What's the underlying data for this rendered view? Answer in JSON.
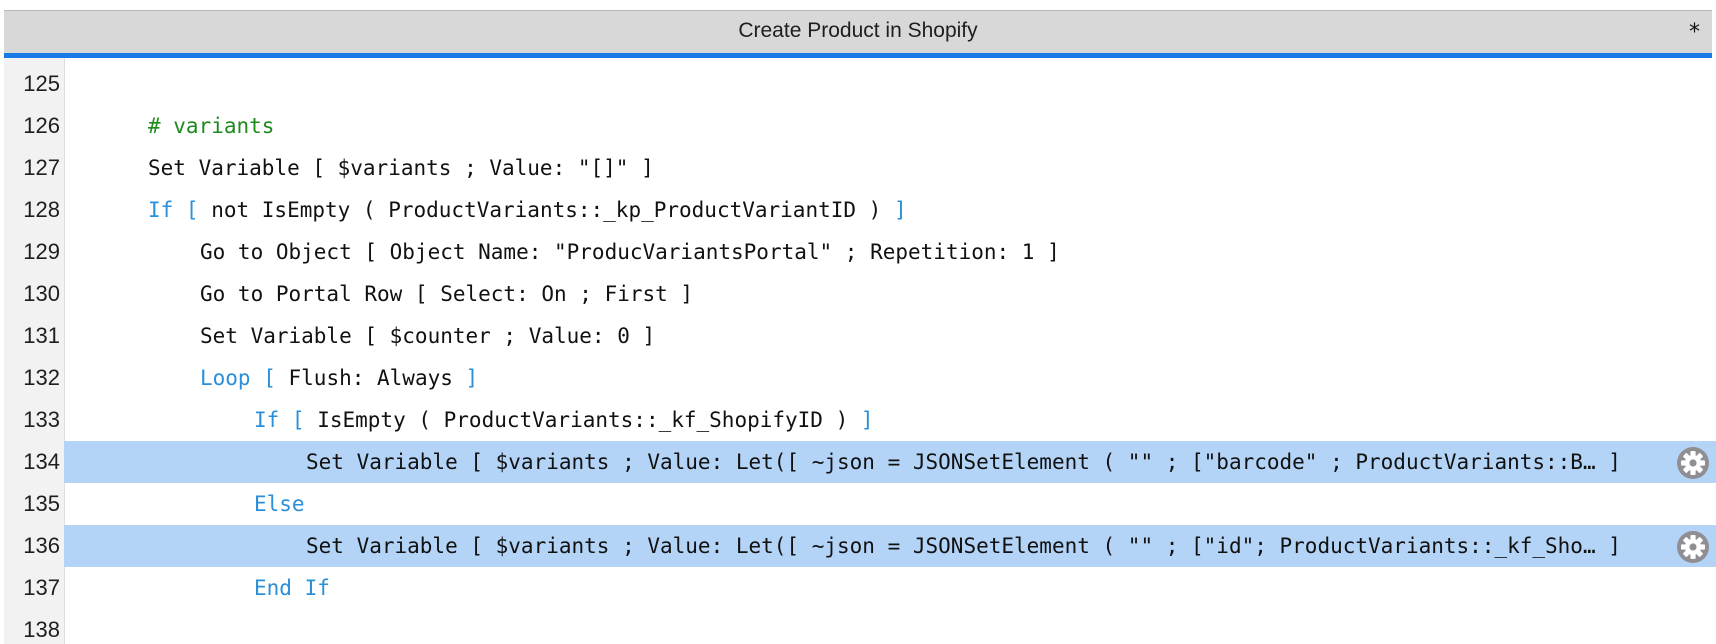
{
  "window": {
    "title": "Create Product in Shopify",
    "modified_marker": "*"
  },
  "colors": {
    "accent": "#1a7be6",
    "selection": "#b3d4f7",
    "keyword": "#2a8fd8",
    "comment": "#1e8a1e"
  },
  "script": {
    "lines": [
      {
        "num": "125",
        "indent": 0,
        "selected": false,
        "parts": []
      },
      {
        "num": "126",
        "indent": 0,
        "selected": false,
        "parts": [
          {
            "t": "# variants",
            "c": "cm"
          }
        ]
      },
      {
        "num": "127",
        "indent": 0,
        "selected": false,
        "parts": [
          {
            "t": "Set Variable [ $variants ; Value: \"[]\" ]",
            "c": ""
          }
        ]
      },
      {
        "num": "128",
        "indent": 0,
        "selected": false,
        "parts": [
          {
            "t": "If [ ",
            "c": "kw"
          },
          {
            "t": "not IsEmpty ( ProductVariants::_kp_ProductVariantID ) ",
            "c": ""
          },
          {
            "t": "]",
            "c": "kw"
          }
        ]
      },
      {
        "num": "129",
        "indent": 1,
        "selected": false,
        "parts": [
          {
            "t": "Go to Object [ Object Name: \"ProducVariantsPortal\" ; Repetition: 1 ]",
            "c": ""
          }
        ]
      },
      {
        "num": "130",
        "indent": 1,
        "selected": false,
        "parts": [
          {
            "t": "Go to Portal Row [ Select: On ; First ]",
            "c": ""
          }
        ]
      },
      {
        "num": "131",
        "indent": 1,
        "selected": false,
        "parts": [
          {
            "t": "Set Variable [ $counter ; Value: 0 ]",
            "c": ""
          }
        ]
      },
      {
        "num": "132",
        "indent": 1,
        "selected": false,
        "parts": [
          {
            "t": "Loop [ ",
            "c": "kw"
          },
          {
            "t": "Flush: Always ",
            "c": ""
          },
          {
            "t": "]",
            "c": "kw"
          }
        ]
      },
      {
        "num": "133",
        "indent": 2,
        "selected": false,
        "parts": [
          {
            "t": "If [ ",
            "c": "kw"
          },
          {
            "t": "IsEmpty ( ProductVariants::_kf_ShopifyID ) ",
            "c": ""
          },
          {
            "t": "]",
            "c": "kw"
          }
        ]
      },
      {
        "num": "134",
        "indent": 3,
        "selected": true,
        "gear": true,
        "parts": [
          {
            "t": "Set Variable [ $variants ; Value: Let([ ~json = JSONSetElement ( \"\" ; [\"barcode\" ; ProductVariants::B… ]",
            "c": ""
          }
        ]
      },
      {
        "num": "135",
        "indent": 2,
        "selected": false,
        "parts": [
          {
            "t": "Else",
            "c": "kw"
          }
        ]
      },
      {
        "num": "136",
        "indent": 3,
        "selected": true,
        "gear": true,
        "parts": [
          {
            "t": "Set Variable [ $variants ; Value: Let([ ~json = JSONSetElement ( \"\" ; [\"id\"; ProductVariants::_kf_Sho… ]",
            "c": ""
          }
        ]
      },
      {
        "num": "137",
        "indent": 2,
        "selected": false,
        "parts": [
          {
            "t": "End If",
            "c": "kw"
          }
        ]
      },
      {
        "num": "138",
        "indent": 0,
        "selected": false,
        "parts": []
      }
    ]
  }
}
